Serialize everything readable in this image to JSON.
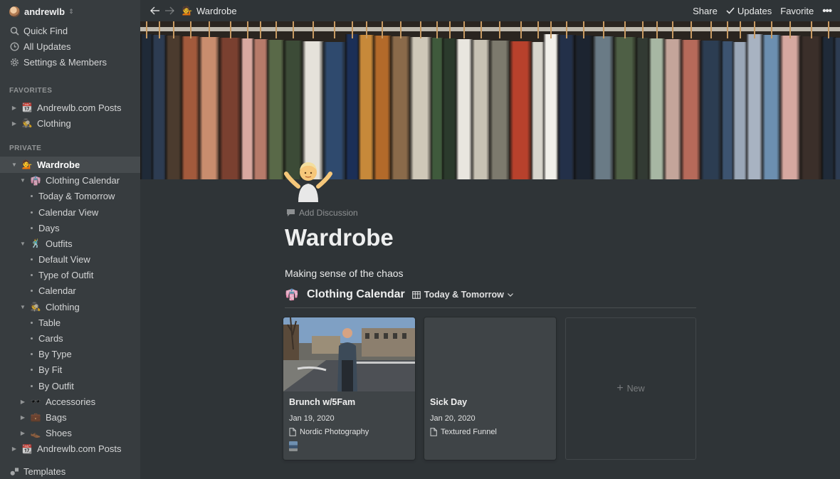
{
  "workspace": {
    "name": "andrewlb"
  },
  "nav": [
    {
      "label": "Quick Find",
      "icon": "search-icon"
    },
    {
      "label": "All Updates",
      "icon": "clock-icon"
    },
    {
      "label": "Settings & Members",
      "icon": "gear-icon"
    }
  ],
  "favorites": {
    "label": "FAVORITES",
    "items": [
      {
        "label": "Andrewlb.com Posts",
        "icon": "calendar-emoji-icon"
      },
      {
        "label": "Clothing",
        "icon": "detective-emoji-icon"
      }
    ]
  },
  "private": {
    "label": "PRIVATE",
    "wardrobe": "Wardrobe",
    "clothing_calendar": "Clothing Calendar",
    "calendar_views": [
      "Today & Tomorrow",
      "Calendar View",
      "Days"
    ],
    "outfits": "Outfits",
    "outfit_views": [
      "Default View",
      "Type of Outfit",
      "Calendar"
    ],
    "clothing": "Clothing",
    "clothing_views": [
      "Table",
      "Cards",
      "By Type",
      "By Fit",
      "By Outfit"
    ],
    "accessories": "Accessories",
    "bags": "Bags",
    "shoes": "Shoes",
    "posts": "Andrewlb.com Posts"
  },
  "templates_label": "Templates",
  "topbar": {
    "breadcrumb": "Wardrobe",
    "share": "Share",
    "updates": "Updates",
    "favorite": "Favorite",
    "more": "•••"
  },
  "page": {
    "add_discussion": "Add Discussion",
    "title": "Wardrobe",
    "description": "Making sense of the chaos"
  },
  "database": {
    "title": "Clothing Calendar",
    "view": "Today & Tomorrow",
    "cards": [
      {
        "title": "Brunch w/5Fam",
        "date": "Jan 19, 2020",
        "relation": "Nordic Photography"
      },
      {
        "title": "Sick Day",
        "date": "Jan 20, 2020",
        "relation": "Textured Funnel"
      }
    ],
    "new_label": "New"
  },
  "colors": {
    "background": "#2f3437",
    "sidebar": "#373c3f",
    "card": "#3f4447"
  }
}
